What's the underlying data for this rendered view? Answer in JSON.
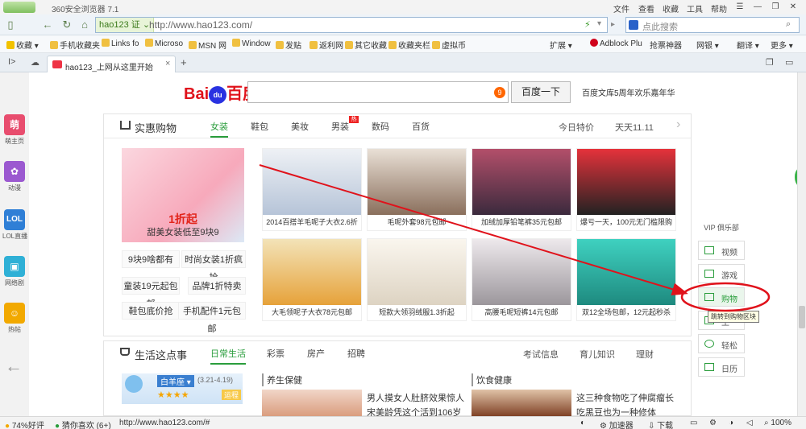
{
  "window": {
    "app_title": "360安全浏览器 7.1",
    "menu": [
      "文件",
      "查看",
      "收藏",
      "工具",
      "帮助"
    ],
    "controls": [
      "☰",
      "—",
      "❐",
      "✕"
    ]
  },
  "address_bar": {
    "site_badge": "hao123 证 ⌄",
    "url": "http://www.hao123.com/",
    "search_placeholder": "点此搜索"
  },
  "bookmarks": {
    "items": [
      "收藏 ▾",
      "手机收藏夹",
      "Links fo",
      "Microso",
      "MSN 网",
      "Window",
      "发贴",
      "返利网",
      "其它收藏",
      "收藏夹栏",
      "虚拟币"
    ],
    "right_items": [
      "扩展 ▾",
      "Adblock Plu",
      "抢票神器",
      "网银 ▾",
      "翻译 ▾",
      "更多 ▾"
    ]
  },
  "tabs": [
    {
      "label": "hao123_上网从这里开始",
      "active": true
    }
  ],
  "left_sidebar": [
    {
      "icon": "萌",
      "label": "萌主页",
      "color": "#e84d6e"
    },
    {
      "icon": "✿",
      "label": "动漫",
      "color": "#9b59d0"
    },
    {
      "icon": "LOL",
      "label": "LOL直播",
      "color": "#2f7fd6"
    },
    {
      "icon": "▣",
      "label": "网络剧",
      "color": "#2fb0d6"
    },
    {
      "icon": "☺",
      "label": "热帖",
      "color": "#f2a900"
    }
  ],
  "baidu": {
    "logo_text": "Bai百度",
    "search_badge": "9",
    "search_button": "百度一下",
    "promo": "百度文库5周年欢乐嘉年华"
  },
  "shopping": {
    "title": "实惠购物",
    "tabs": [
      {
        "label": "女装",
        "active": true
      },
      {
        "label": "鞋包"
      },
      {
        "label": "美妆"
      },
      {
        "label": "男装",
        "hot": "热"
      },
      {
        "label": "数码"
      },
      {
        "label": "百货"
      }
    ],
    "right_links": [
      "今日特价",
      "天天11.11"
    ],
    "promo_title": "1折起",
    "promo_sub": "甜美女装低至9块9",
    "quick_links": [
      "9块9啥都有",
      "时尚女装1折疯抢",
      "童装19元起包邮",
      "品牌1折特卖",
      "鞋包底价抢",
      "手机配件1元包邮"
    ],
    "products": [
      {
        "caption": "2014百搭羊毛呢子大衣2.6折",
        "color": "#d7dce4"
      },
      {
        "caption": "毛呢外套98元包邮",
        "color": "#8a6f5c"
      },
      {
        "caption": "加绒加厚铅笔裤35元包邮",
        "color": "#6b4d5f"
      },
      {
        "caption": "爆亏一天，100元无门槛限购",
        "color": "#e5323b"
      },
      {
        "caption": "大毛领呢子大衣78元包邮",
        "color": "#e6a23a"
      },
      {
        "caption": "短款大领羽绒服1.3折起",
        "color": "#f2ece2"
      },
      {
        "caption": "高腰毛呢短裤14元包邮",
        "color": "#b8b3b8"
      },
      {
        "caption": "双12全场包邮，12元起秒杀",
        "color": "#22b3a2"
      }
    ]
  },
  "life": {
    "title": "生活这点事",
    "tabs": [
      {
        "label": "日常生活",
        "active": true
      },
      {
        "label": "彩票"
      },
      {
        "label": "房产"
      },
      {
        "label": "招聘"
      }
    ],
    "right_links": [
      "考试信息",
      "育儿知识",
      "理财"
    ],
    "zodiac": "白羊座 ▾",
    "zodiac_dates": "(3.21-4.19)",
    "zodiac_badge": "运程",
    "col1_title": "养生保健",
    "col2_title": "饮食健康",
    "news1": [
      "男人摸女人肚脐效果惊人",
      "宋美龄凭这个活到106岁"
    ],
    "news2": [
      "这三种食物吃了伸腐瘤长",
      "吃黑豆也为一种修体"
    ]
  },
  "vip_panel": {
    "header": "VIP 俱乐部",
    "items": [
      "视频",
      "游戏",
      "购物",
      "生",
      "轻松",
      "日历"
    ],
    "tooltip": "跳转到购物区块"
  },
  "status_bar": {
    "rating": "74%好评",
    "guess": "猜你喜欢 (6+)",
    "url": "http://www.hao123.com/#",
    "accelerator": "加速器",
    "download": "下载",
    "zoom": "100%"
  },
  "colors": {
    "accent_green": "#2a9d3c",
    "annotation_red": "#e0121b",
    "baidu_blue": "#2932e1"
  }
}
